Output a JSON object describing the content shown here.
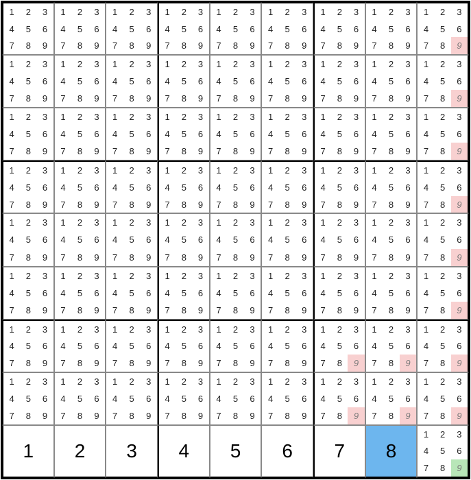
{
  "candidate_values": [
    1,
    2,
    3,
    4,
    5,
    6,
    7,
    8,
    9
  ],
  "grid": {
    "rows": [
      [
        {
          "t": "p"
        },
        {
          "t": "p"
        },
        {
          "t": "p"
        },
        {
          "t": "p"
        },
        {
          "t": "p"
        },
        {
          "t": "p"
        },
        {
          "t": "p"
        },
        {
          "t": "p"
        },
        {
          "t": "p",
          "hi": {
            "9": "red"
          }
        }
      ],
      [
        {
          "t": "p"
        },
        {
          "t": "p"
        },
        {
          "t": "p"
        },
        {
          "t": "p"
        },
        {
          "t": "p"
        },
        {
          "t": "p"
        },
        {
          "t": "p"
        },
        {
          "t": "p"
        },
        {
          "t": "p",
          "hi": {
            "9": "red"
          }
        }
      ],
      [
        {
          "t": "p"
        },
        {
          "t": "p"
        },
        {
          "t": "p"
        },
        {
          "t": "p"
        },
        {
          "t": "p"
        },
        {
          "t": "p"
        },
        {
          "t": "p"
        },
        {
          "t": "p"
        },
        {
          "t": "p",
          "hi": {
            "9": "red"
          }
        }
      ],
      [
        {
          "t": "p"
        },
        {
          "t": "p"
        },
        {
          "t": "p"
        },
        {
          "t": "p"
        },
        {
          "t": "p"
        },
        {
          "t": "p"
        },
        {
          "t": "p"
        },
        {
          "t": "p"
        },
        {
          "t": "p",
          "hi": {
            "9": "red"
          }
        }
      ],
      [
        {
          "t": "p"
        },
        {
          "t": "p"
        },
        {
          "t": "p"
        },
        {
          "t": "p"
        },
        {
          "t": "p"
        },
        {
          "t": "p"
        },
        {
          "t": "p"
        },
        {
          "t": "p"
        },
        {
          "t": "p",
          "hi": {
            "9": "red"
          }
        }
      ],
      [
        {
          "t": "p"
        },
        {
          "t": "p"
        },
        {
          "t": "p"
        },
        {
          "t": "p"
        },
        {
          "t": "p"
        },
        {
          "t": "p"
        },
        {
          "t": "p"
        },
        {
          "t": "p"
        },
        {
          "t": "p",
          "hi": {
            "9": "red"
          }
        }
      ],
      [
        {
          "t": "p"
        },
        {
          "t": "p"
        },
        {
          "t": "p"
        },
        {
          "t": "p"
        },
        {
          "t": "p"
        },
        {
          "t": "p"
        },
        {
          "t": "p",
          "hi": {
            "9": "red"
          }
        },
        {
          "t": "p",
          "hi": {
            "9": "red"
          }
        },
        {
          "t": "p",
          "hi": {
            "9": "red"
          }
        }
      ],
      [
        {
          "t": "p"
        },
        {
          "t": "p"
        },
        {
          "t": "p"
        },
        {
          "t": "p"
        },
        {
          "t": "p"
        },
        {
          "t": "p"
        },
        {
          "t": "p",
          "hi": {
            "9": "red"
          }
        },
        {
          "t": "p",
          "hi": {
            "9": "red"
          }
        },
        {
          "t": "p",
          "hi": {
            "9": "red"
          }
        }
      ],
      [
        {
          "t": "s",
          "v": 1
        },
        {
          "t": "s",
          "v": 2
        },
        {
          "t": "s",
          "v": 3
        },
        {
          "t": "s",
          "v": 4
        },
        {
          "t": "s",
          "v": 5
        },
        {
          "t": "s",
          "v": 6
        },
        {
          "t": "s",
          "v": 7
        },
        {
          "t": "s",
          "v": 8,
          "sel": true
        },
        {
          "t": "p",
          "hi": {
            "9": "green"
          }
        }
      ]
    ]
  }
}
